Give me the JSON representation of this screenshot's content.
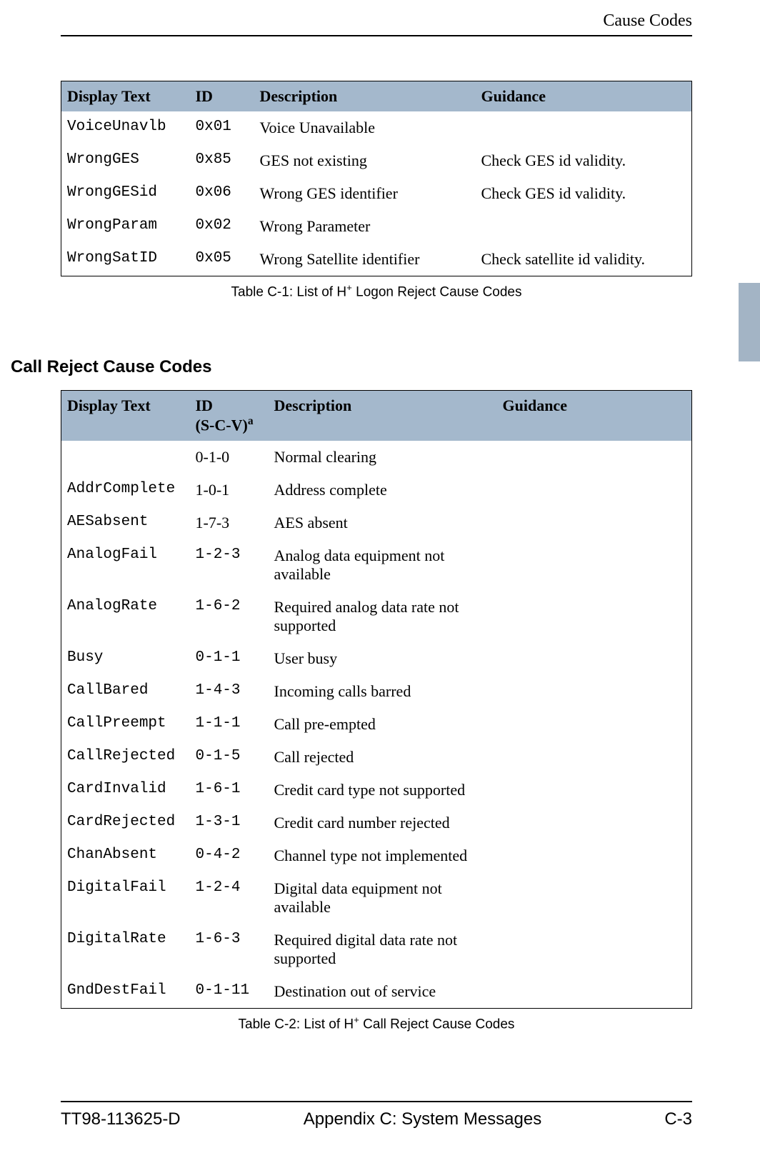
{
  "header": {
    "title": "Cause Codes"
  },
  "table1": {
    "headers": {
      "c1": "Display Text",
      "c2": "ID",
      "c3": "Description",
      "c4": "Guidance"
    },
    "rows": [
      {
        "display": "VoiceUnavlb",
        "id": "0x01",
        "desc": "Voice Unavailable",
        "guidance": ""
      },
      {
        "display": "WrongGES",
        "id": "0x85",
        "desc": "GES not existing",
        "guidance": "Check GES id validity."
      },
      {
        "display": "WrongGESid",
        "id": "0x06",
        "desc": "Wrong GES identifier",
        "guidance": "Check GES id validity."
      },
      {
        "display": "WrongParam",
        "id": "0x02",
        "desc": "Wrong Parameter",
        "guidance": ""
      },
      {
        "display": "WrongSatID",
        "id": "0x05",
        "desc": "Wrong Satellite identifier",
        "guidance": "Check satellite id validity."
      }
    ],
    "caption_pre": "Table C-1: List of H",
    "caption_sup": "+",
    "caption_post": " Logon Reject Cause Codes"
  },
  "section2": {
    "heading": "Call Reject Cause Codes"
  },
  "table2": {
    "headers": {
      "c1": "Display Text",
      "c2a": "ID",
      "c2b": "(S-C-V)",
      "c2sup": "a",
      "c3": "Description",
      "c4": "Guidance"
    },
    "rows": [
      {
        "display": "",
        "id": "0-1-0",
        "desc": "Normal clearing",
        "guidance": ""
      },
      {
        "display": "AddrComplete",
        "id": "1-0-1",
        "desc": "Address complete",
        "guidance": ""
      },
      {
        "display": "AESabsent",
        "id": "1-7-3",
        "desc": "AES absent",
        "guidance": ""
      },
      {
        "display": "AnalogFail",
        "id": "1-2-3",
        "desc": "Analog data equipment not available",
        "guidance": ""
      },
      {
        "display": "AnalogRate",
        "id": "1-6-2",
        "desc": "Required analog data rate not supported",
        "guidance": ""
      },
      {
        "display": "Busy",
        "id": "0-1-1",
        "desc": "User busy",
        "guidance": ""
      },
      {
        "display": "CallBared",
        "id": "1-4-3",
        "desc": "Incoming calls barred",
        "guidance": ""
      },
      {
        "display": "CallPreempt",
        "id": "1-1-1",
        "desc": "Call pre-empted",
        "guidance": ""
      },
      {
        "display": "CallRejected",
        "id": "0-1-5",
        "desc": "Call rejected",
        "guidance": ""
      },
      {
        "display": "CardInvalid",
        "id": "1-6-1",
        "desc": "Credit card type not supported",
        "guidance": ""
      },
      {
        "display": "CardRejected",
        "id": "1-3-1",
        "desc": "Credit card number rejected",
        "guidance": ""
      },
      {
        "display": "ChanAbsent",
        "id": "0-4-2",
        "desc": "Channel type not implemented",
        "guidance": ""
      },
      {
        "display": "DigitalFail",
        "id": "1-2-4",
        "desc": "Digital data equipment not available",
        "guidance": ""
      },
      {
        "display": "DigitalRate",
        "id": "1-6-3",
        "desc": "Required digital data rate not supported",
        "guidance": ""
      },
      {
        "display": "GndDestFail",
        "id": "0-1-11",
        "desc": "Destination out of service",
        "guidance": ""
      }
    ],
    "caption_pre": "Table C-2: List of H",
    "caption_sup": "+",
    "caption_post": " Call Reject Cause Codes"
  },
  "footer": {
    "left": "TT98-113625-D",
    "center": "Appendix C:  System Messages",
    "right": "C-3"
  }
}
